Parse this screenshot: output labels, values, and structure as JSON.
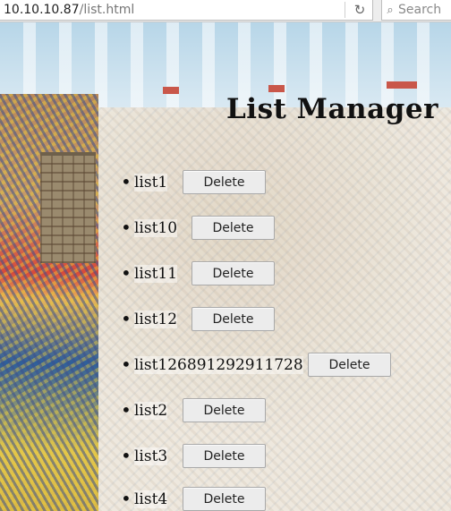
{
  "browser": {
    "url_host": "10.10.10.87",
    "url_path": "/list.html",
    "search_placeholder": "Search",
    "reload_icon": "reload-icon",
    "search_icon": "search-icon"
  },
  "page": {
    "title": "List Manager",
    "delete_label": "Delete",
    "items": [
      {
        "name": "list1"
      },
      {
        "name": "list10"
      },
      {
        "name": "list11"
      },
      {
        "name": "list12"
      },
      {
        "name": "list126891292911728"
      },
      {
        "name": "list2"
      },
      {
        "name": "list3"
      },
      {
        "name": "list4"
      }
    ]
  }
}
